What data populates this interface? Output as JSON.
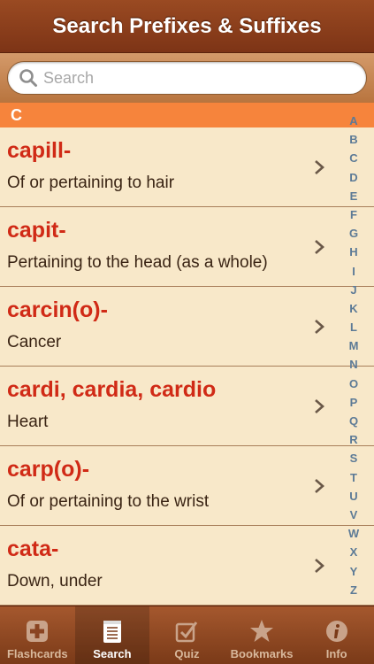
{
  "nav": {
    "title": "Search Prefixes & Suffixes"
  },
  "search": {
    "placeholder": "Search"
  },
  "section": {
    "letter": "C"
  },
  "rows": [
    {
      "term": "capill-",
      "definition": "Of or pertaining to hair"
    },
    {
      "term": "capit-",
      "definition": "Pertaining to the head (as a whole)"
    },
    {
      "term": "carcin(o)-",
      "definition": "Cancer"
    },
    {
      "term": "cardi, cardia, cardio",
      "definition": "Heart"
    },
    {
      "term": "carp(o)-",
      "definition": "Of or pertaining to the wrist"
    },
    {
      "term": "cata-",
      "definition": "Down, under"
    }
  ],
  "index": [
    "A",
    "B",
    "C",
    "D",
    "E",
    "F",
    "G",
    "H",
    "I",
    "J",
    "K",
    "L",
    "M",
    "N",
    "O",
    "P",
    "Q",
    "R",
    "S",
    "T",
    "U",
    "V",
    "W",
    "X",
    "Y",
    "Z"
  ],
  "tabs": [
    {
      "label": "Flashcards",
      "icon": "plus-card-icon",
      "active": false
    },
    {
      "label": "Search",
      "icon": "notepad-icon",
      "active": true
    },
    {
      "label": "Quiz",
      "icon": "checkbox-icon",
      "active": false
    },
    {
      "label": "Bookmarks",
      "icon": "star-icon",
      "active": false
    },
    {
      "label": "Info",
      "icon": "info-icon",
      "active": false
    }
  ],
  "colors": {
    "accent": "#f6843c",
    "term": "#d02a16",
    "nav": "#8a3c1a",
    "index": "#5c7a96"
  }
}
